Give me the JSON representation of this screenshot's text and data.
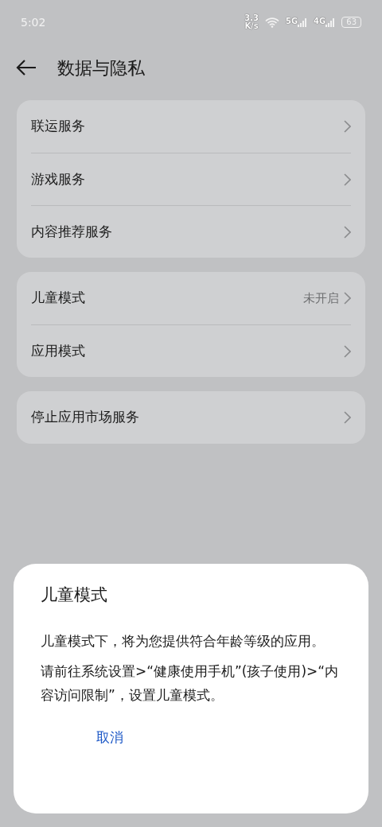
{
  "status_bar": {
    "time": "5:02",
    "speed_value": "3.3",
    "speed_unit": "K/s",
    "network_1": "5G",
    "network_2": "4G",
    "battery": "63"
  },
  "header": {
    "title": "数据与隐私"
  },
  "groups": [
    {
      "items": [
        {
          "label": "联运服务"
        },
        {
          "label": "游戏服务"
        },
        {
          "label": "内容推荐服务"
        }
      ]
    },
    {
      "items": [
        {
          "label": "儿童模式",
          "value": "未开启"
        },
        {
          "label": "应用模式"
        }
      ]
    },
    {
      "items": [
        {
          "label": "停止应用市场服务"
        }
      ]
    }
  ],
  "dialog": {
    "title": "儿童模式",
    "paragraphs": [
      "儿童模式下，将为您提供符合年龄等级的应用。",
      "请前往系统设置>“健康使用手机”(孩子使用)>“内容访问限制”，设置儿童模式。"
    ],
    "buttons": [
      "取消"
    ]
  }
}
